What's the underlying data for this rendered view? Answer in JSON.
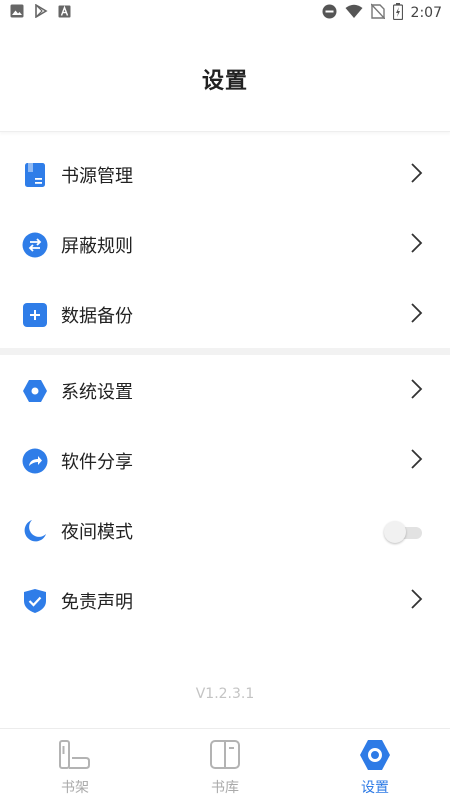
{
  "status_bar": {
    "time": "2:07",
    "left_icons": [
      "image-icon",
      "play-store-icon",
      "a-letter-icon"
    ],
    "right_icons": [
      "dnd-icon",
      "wifi-icon",
      "no-sim-icon",
      "battery-icon"
    ]
  },
  "header": {
    "title": "设置"
  },
  "settings": {
    "group1": [
      {
        "label": "书源管理",
        "icon": "book-source-icon",
        "accessory": "chevron"
      },
      {
        "label": "屏蔽规则",
        "icon": "swap-arrows-icon",
        "accessory": "chevron"
      },
      {
        "label": "数据备份",
        "icon": "plus-box-icon",
        "accessory": "chevron"
      }
    ],
    "group2": [
      {
        "label": "系统设置",
        "icon": "hexagon-gear-icon",
        "accessory": "chevron"
      },
      {
        "label": "软件分享",
        "icon": "share-arrow-icon",
        "accessory": "chevron"
      },
      {
        "label": "夜间模式",
        "icon": "moon-icon",
        "accessory": "toggle",
        "toggle_on": false
      },
      {
        "label": "免责声明",
        "icon": "shield-check-icon",
        "accessory": "chevron"
      }
    ]
  },
  "version": "V1.2.3.1",
  "bottom_nav": {
    "items": [
      {
        "label": "书架",
        "icon": "bookshelf-icon",
        "active": false
      },
      {
        "label": "书库",
        "icon": "library-book-icon",
        "active": false
      },
      {
        "label": "设置",
        "icon": "settings-hexagon-icon",
        "active": true
      }
    ]
  },
  "colors": {
    "accent": "#2e7be6",
    "icon_blue": "#2f7de8",
    "inactive": "#aaaaaa",
    "chevron": "#333333"
  }
}
